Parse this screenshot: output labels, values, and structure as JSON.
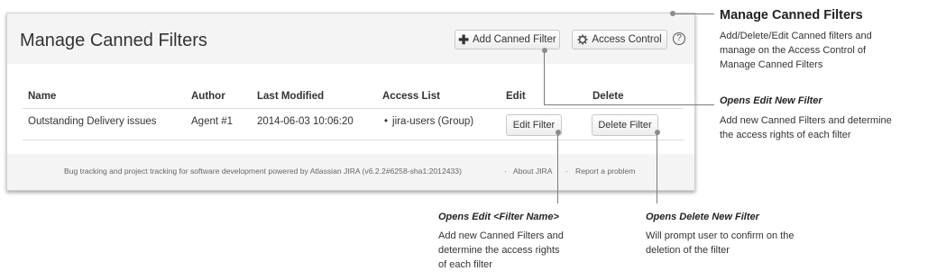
{
  "panel": {
    "title": "Manage Canned Filters",
    "add_button_label": "Add Canned Filter",
    "access_button_label": "Access Control",
    "help_glyph": "?"
  },
  "table": {
    "headers": [
      "Name",
      "Author",
      "Last Modified",
      "Access List",
      "Edit",
      "Delete"
    ],
    "rows": [
      {
        "name": "Outstanding Delivery issues",
        "author": "Agent #1",
        "last_modified": "2014-06-03 10:06:20",
        "access": "jira-users (Group)",
        "edit_label": "Edit Filter",
        "delete_label": "Delete Filter"
      }
    ]
  },
  "footer": {
    "credit": "Bug tracking and project tracking for software development powered by Atlassian JIRA (v6.2.2#6258-sha1:2012433)",
    "sep": "·",
    "about": "About JIRA",
    "report": "Report a problem"
  },
  "annotations": {
    "manage": {
      "title": "Manage Canned Filters",
      "lines": [
        "Add/Delete/Edit Canned filters and",
        "manage on the Access Control of",
        "Manage Canned Filters"
      ]
    },
    "edit_new": {
      "heading": "Opens Edit New Filter",
      "lines": [
        "Add new Canned Filters and determine",
        "the access rights of each filter"
      ]
    },
    "edit_name": {
      "heading": "Opens Edit <Filter Name>",
      "lines": [
        "Add new Canned Filters and",
        "determine the access rights",
        "of each filter"
      ]
    },
    "delete": {
      "heading": "Opens Delete New Filter",
      "lines": [
        "Will prompt user to confirm on the",
        "deletion of the filter"
      ]
    }
  },
  "icons": {
    "add": "plus-icon",
    "access": "gear-icon",
    "help": "help-icon",
    "bullet": "bullet-icon"
  },
  "colors": {
    "panel_bg": "#f4f4f4",
    "annotation_line": "#7a7a7a"
  }
}
